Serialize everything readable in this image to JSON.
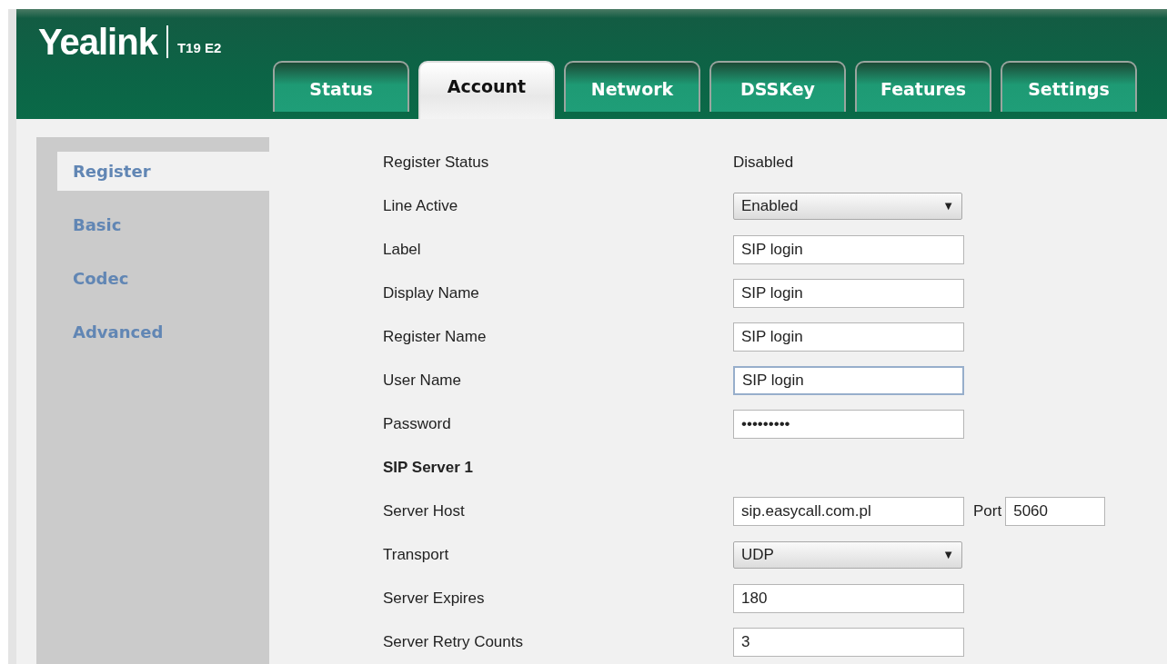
{
  "header": {
    "logo": "Yealink",
    "model": "T19 E2"
  },
  "tabs": [
    {
      "label": "Status",
      "selected": false
    },
    {
      "label": "Account",
      "selected": true
    },
    {
      "label": "Network",
      "selected": false
    },
    {
      "label": "DSSKey",
      "selected": false
    },
    {
      "label": "Features",
      "selected": false
    },
    {
      "label": "Settings",
      "selected": false
    }
  ],
  "sidebar": {
    "items": [
      {
        "label": "Register",
        "selected": true
      },
      {
        "label": "Basic",
        "selected": false
      },
      {
        "label": "Codec",
        "selected": false
      },
      {
        "label": "Advanced",
        "selected": false
      }
    ]
  },
  "form": {
    "rows": [
      {
        "kind": "static",
        "label": "Register Status",
        "value": "Disabled"
      },
      {
        "kind": "select",
        "label": "Line Active",
        "value": "Enabled",
        "caret": "▼"
      },
      {
        "kind": "input",
        "label": "Label",
        "value": "SIP login"
      },
      {
        "kind": "input",
        "label": "Display Name",
        "value": "SIP login"
      },
      {
        "kind": "input",
        "label": "Register Name",
        "value": "SIP login"
      },
      {
        "kind": "input",
        "label": "User Name",
        "value": "SIP login",
        "focused": true
      },
      {
        "kind": "input",
        "label": "Password",
        "value": "•••••••••"
      },
      {
        "kind": "heading",
        "label": "SIP Server 1"
      },
      {
        "kind": "host",
        "label": "Server Host",
        "value": "sip.easycall.com.pl",
        "port_label": "Port",
        "port": "5060"
      },
      {
        "kind": "select",
        "label": "Transport",
        "value": "UDP",
        "caret": "▼"
      },
      {
        "kind": "input",
        "label": "Server Expires",
        "value": "180"
      },
      {
        "kind": "input",
        "label": "Server Retry Counts",
        "value": "3"
      }
    ]
  }
}
